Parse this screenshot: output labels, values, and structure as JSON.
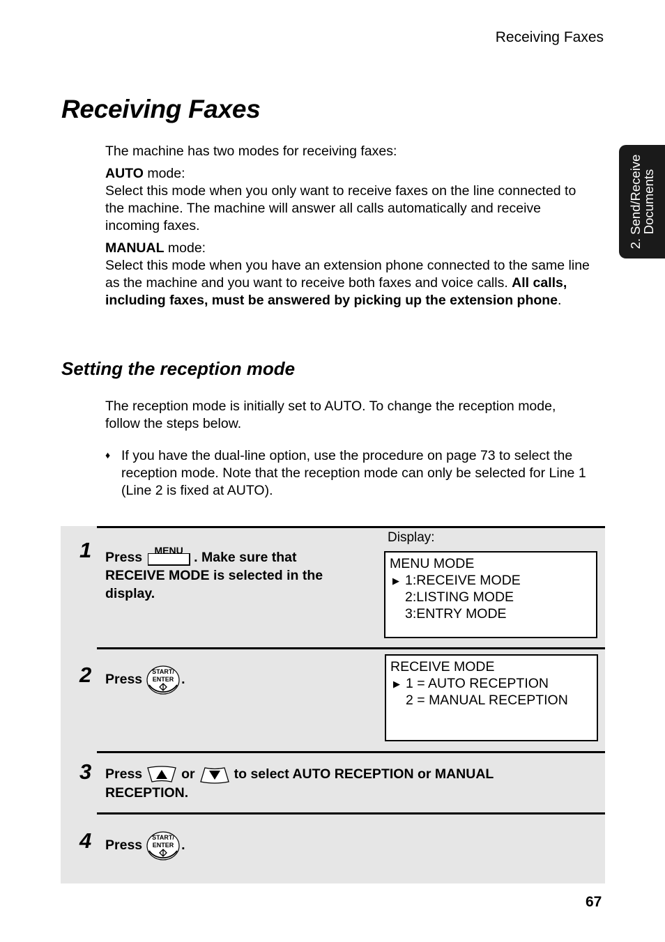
{
  "running_header": "Receiving Faxes",
  "side_tab": {
    "line1": "2. Send/Receive",
    "line2": "Documents"
  },
  "page_title": "Receiving Faxes",
  "intro": "The machine has two modes for receiving faxes:",
  "modes": [
    {
      "name": "AUTO",
      "suffix": " mode:",
      "description": "Select this mode when you only want to receive faxes on the line connected to the machine. The machine will answer all calls automatically and receive incoming faxes."
    },
    {
      "name": "MANUAL",
      "suffix": " mode:",
      "description": "Select this mode when you have an extension phone connected to the same line as the machine and you want to receive both faxes and voice calls. ",
      "description_bold": "All calls, including faxes, must be answered by picking up the extension phone",
      "description_end": "."
    }
  ],
  "section_title": "Setting the reception mode",
  "section_intro": "The reception mode is initially set to AUTO. To change the reception mode, follow the steps below.",
  "bullet": {
    "glyph": "♦",
    "text": "If you have the dual-line option, use the procedure on page 73 to select the reception mode. Note that the reception mode can only be selected for Line 1 (Line 2 is fixed at AUTO)."
  },
  "display_label": "Display:",
  "steps": [
    {
      "number": "1",
      "press": "Press",
      "key_label": "MENU",
      "text_after": ". Make sure that RECEIVE MODE is selected in the display.",
      "display": {
        "title": "MENU MODE",
        "lines": [
          "1:RECEIVE MODE",
          "2:LISTING MODE",
          "3:ENTRY MODE"
        ],
        "selected_index": 0
      }
    },
    {
      "number": "2",
      "press": "Press",
      "key_label_top": "START/",
      "key_label_bottom": "ENTER",
      "text_after": ".",
      "display": {
        "title": "RECEIVE MODE",
        "lines": [
          "1 = AUTO RECEPTION",
          "2 = MANUAL RECEPTION"
        ],
        "selected_index": 0
      }
    },
    {
      "number": "3",
      "press": "Press",
      "or": "or",
      "text_after": "to select AUTO RECEPTION or MANUAL",
      "text_line2": "RECEPTION."
    },
    {
      "number": "4",
      "press": "Press",
      "key_label_top": "START/",
      "key_label_bottom": "ENTER",
      "text_after": "."
    }
  ],
  "page_number": "67"
}
